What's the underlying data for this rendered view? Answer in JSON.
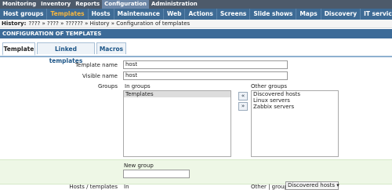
{
  "top_menu": [
    "Monitoring",
    "Inventory",
    "Reports",
    "Configuration",
    "Administration"
  ],
  "sub_menu": [
    "Host groups",
    "Templates",
    "Hosts",
    "Maintenance",
    "Web",
    "Actions",
    "Screens",
    "Slide shows",
    "Maps",
    "Discovery",
    "IT services"
  ],
  "history": {
    "label": "History:",
    "path": "???? » ???? » ?????? » History » Configuration of templates"
  },
  "section_title": "CONFIGURATION OF TEMPLATES",
  "tabs": [
    "Template",
    "Linked templates",
    "Macros"
  ],
  "form": {
    "template_name_label": "Template name",
    "template_name_value": "host",
    "visible_name_label": "Visible name",
    "visible_name_value": "host",
    "groups_label": "Groups",
    "in_groups_label": "In groups",
    "in_groups": [
      "Templates"
    ],
    "other_groups_label": "Other groups",
    "other_groups": [
      "Discovered hosts",
      "Linux servers",
      "Zabbix servers"
    ],
    "move_left": "«",
    "move_right": "»",
    "new_group_label": "New group",
    "new_group_value": "",
    "hosts_templates_label": "Hosts / templates",
    "in_label": "In",
    "other_group_label": "Other | group",
    "other_group_selected": "Discovered hosts ▾"
  },
  "colors": {
    "top_menu_bg": "#4d5a6a",
    "sub_menu_bg": "#3e6b95",
    "active_sub_item": "#f7b740",
    "section_bg": "#3c6b98",
    "new_group_bg": "#eef7e6"
  }
}
